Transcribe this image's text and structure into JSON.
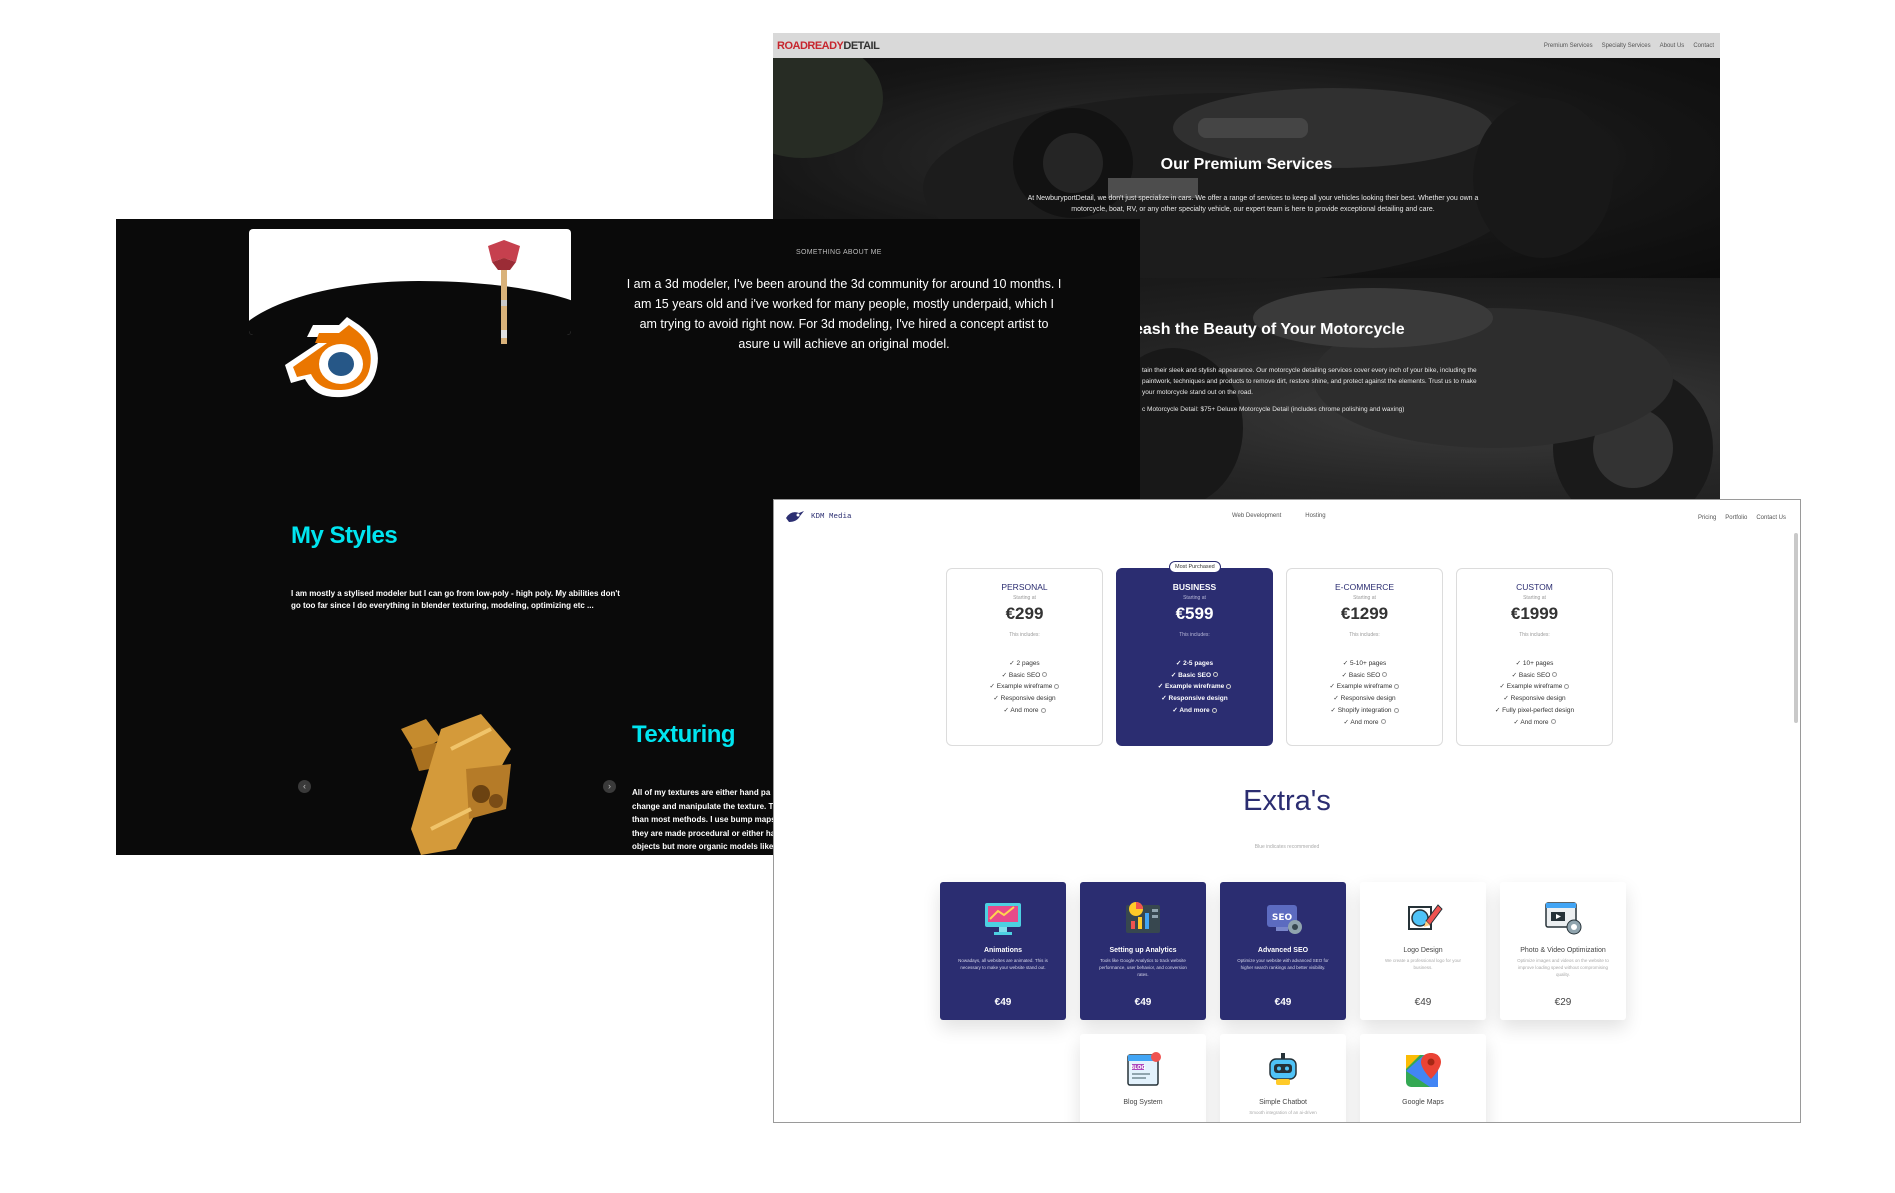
{
  "road": {
    "logo_red": "ROADREADY",
    "logo_dark": "DETAIL",
    "nav": [
      "Premium Services",
      "Specialty Services",
      "About Us",
      "Contact"
    ],
    "hero_title": "Our Premium Services",
    "hero_text": "At NewburyportDetail, we don't just specialize in cars. We offer a range of services to keep all your vehicles looking their best. Whether you own a motorcycle, boat, RV, or any other specialty vehicle, our expert team is here to provide exceptional detailing and care.",
    "moto_title": "eash the Beauty of Your Motorcycle",
    "moto_text": "tain their sleek and stylish appearance. Our motorcycle detailing services cover every inch of your bike, including the paintwork, techniques and products to remove dirt, restore shine, and protect against the elements. Trust us to make your motorcycle stand out on the road.",
    "moto_price": "c Motorcycle Detail: $75+ Deluxe Motorcycle Detail (includes chrome polishing and waxing)"
  },
  "portfolio": {
    "about_label": "SOMETHING ABOUT ME",
    "about_text": "I am a 3d modeler, I've been around the 3d community for around 10 months. I am 15 years old and i've worked for many people, mostly underpaid, which I am trying to avoid right now. For 3d modeling, I've hired a concept artist to asure u will achieve an original model.",
    "styles_title": "My Styles",
    "styles_text": "I am mostly a stylised modeler but I can go from low-poly - high poly. My abilities don't go too far since I do everything in blender texturing, modeling, optimizing etc ...",
    "texturing_title": "Texturing",
    "texturing_lines": [
      "All of my textures are either hand pa",
      "change and manipulate the texture. The",
      "than most methods. I use bump maps",
      "they are made procedural or either hand",
      "objects but more organic models like hu"
    ],
    "prev_icon": "‹",
    "next_icon": "›",
    "accent": "#00e5f0"
  },
  "kdm": {
    "logo_text": "KDM Media",
    "nav_mid": [
      "Web Development",
      "Hosting"
    ],
    "nav_right": [
      "Pricing",
      "Portfolio",
      "Contact Us"
    ],
    "accent": "#2b2d71",
    "plans": [
      {
        "name": "PERSONAL",
        "from": "Starting at",
        "price": "€299",
        "includes": "This includes:",
        "features": [
          "✓ 2 pages",
          "✓ Basic SEO",
          "✓ Example wireframe",
          "✓ Responsive design",
          "✓ And more"
        ]
      },
      {
        "name": "BUSINESS",
        "badge": "Most Purchased",
        "from": "Starting at",
        "price": "€599",
        "includes": "This includes:",
        "features": [
          "✓ 2-5 pages",
          "✓ Basic SEO",
          "✓ Example wireframe",
          "✓ Responsive design",
          "✓ And more"
        ]
      },
      {
        "name": "E-COMMERCE",
        "from": "Starting at",
        "price": "€1299",
        "includes": "This includes:",
        "features": [
          "✓ 5-10+ pages",
          "✓ Basic SEO",
          "✓ Example wireframe",
          "✓ Responsive design",
          "✓ Shopify integration",
          "✓ And more"
        ]
      },
      {
        "name": "CUSTOM",
        "from": "Starting at",
        "price": "€1999",
        "includes": "This includes:",
        "features": [
          "✓ 10+ pages",
          "✓ Basic SEO",
          "✓ Example wireframe",
          "✓ Responsive design",
          "✓ Fully pixel-perfect design",
          "✓ And more"
        ]
      }
    ],
    "extras_title": "Extra's",
    "extras_sub": "Blue indicates recommended",
    "extras": [
      {
        "name": "Animations",
        "icon": "monitor-animation-icon",
        "desc": "Nowadays, all websites are animated. This is necessary to make your website stand out.",
        "price": "€49",
        "recommended": true
      },
      {
        "name": "Setting up Analytics",
        "icon": "analytics-chart-icon",
        "desc": "Tools like Google Analytics to track website performance, user behavior, and conversion rates.",
        "price": "€49",
        "recommended": true
      },
      {
        "name": "Advanced SEO",
        "icon": "seo-gear-icon",
        "desc": "Optimize your website with advanced SEO for higher search rankings and better visibility.",
        "price": "€49",
        "recommended": true
      },
      {
        "name": "Logo Design",
        "icon": "logo-design-pen-icon",
        "desc": "We create a professional logo for your business.",
        "price": "€49",
        "recommended": false
      },
      {
        "name": "Photo & Video Optimization",
        "icon": "photo-video-gear-icon",
        "desc": "Optimize images and videos on the website to improve loading speed without compromising quality.",
        "price": "€29",
        "recommended": false
      },
      {
        "name": "Blog System",
        "icon": "blog-icon",
        "desc": "",
        "price": "",
        "recommended": false
      },
      {
        "name": "Simple Chatbot",
        "icon": "chatbot-icon",
        "desc": "Smooth integration of an ai-driven",
        "price": "",
        "recommended": false
      },
      {
        "name": "Google Maps",
        "icon": "google-maps-icon",
        "desc": "",
        "price": "",
        "recommended": false
      }
    ]
  }
}
